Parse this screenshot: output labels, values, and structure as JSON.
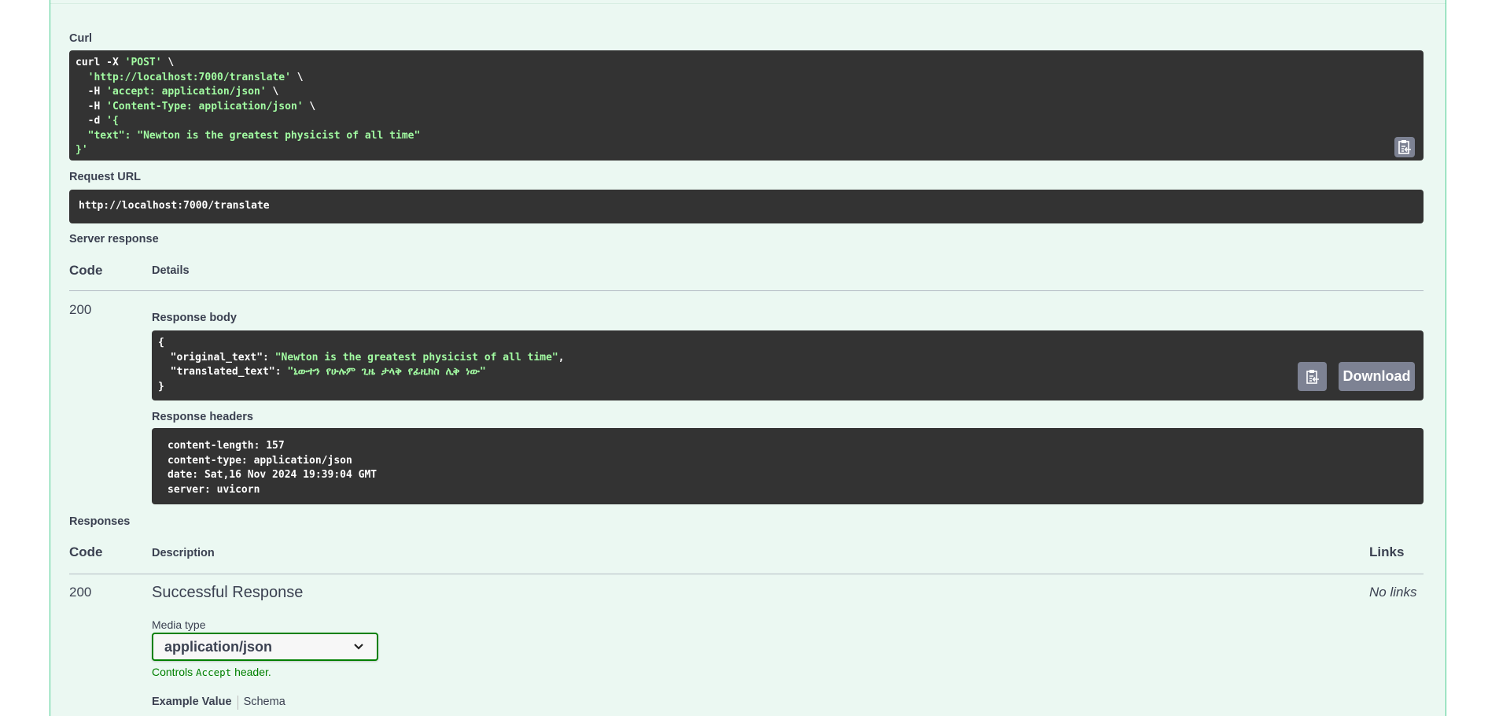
{
  "curl": {
    "label": "Curl",
    "lines": [
      [
        "curl -X ",
        "'POST'",
        " \\"
      ],
      [
        "  ",
        "'http://localhost:7000/translate'",
        " \\"
      ],
      [
        "  -H ",
        "'accept: application/json'",
        " \\"
      ],
      [
        "  -H ",
        "'Content-Type: application/json'",
        " \\"
      ],
      [
        "  -d ",
        "'{",
        ""
      ],
      [
        "  ",
        "\"text\": \"Newton is the greatest physicist of all time\"",
        ""
      ],
      [
        "",
        "}'",
        ""
      ]
    ],
    "copy_icon": "clipboard-copy-icon"
  },
  "request_url": {
    "label": "Request URL",
    "value": "http://localhost:7000/translate"
  },
  "server_response": {
    "label": "Server response",
    "col_code": "Code",
    "col_details": "Details",
    "code": "200",
    "body_label": "Response body",
    "body": {
      "open": "{",
      "k1": "  \"original_text\": ",
      "v1": "\"Newton is the greatest physicist of all time\"",
      "c": ",",
      "k2": "  \"translated_text\": ",
      "v2": "\"ኒውተን የሁሉም ጊዜ ታላቅ የፊዚክስ ሊቅ ነው\"",
      "close": "}"
    },
    "download_label": "Download",
    "headers_label": "Response headers",
    "headers": [
      "content-length: 157",
      "content-type: application/json",
      "date: Sat,16 Nov 2024 19:39:04 GMT",
      "server: uvicorn"
    ]
  },
  "responses": {
    "label": "Responses",
    "col_code": "Code",
    "col_description": "Description",
    "col_links": "Links",
    "code": "200",
    "description": "Successful Response",
    "links": "No links",
    "media_type_label": "Media type",
    "media_type": "application/json",
    "controls_pre": "Controls ",
    "controls_code": "Accept",
    "controls_post": " header.",
    "tab_example": "Example Value",
    "tab_schema": "Schema"
  },
  "colors": {
    "border": "#49cc90",
    "background": "#ebf8f2",
    "code_bg": "#333333",
    "string": "#a2fca2",
    "select_border": "#008000"
  }
}
